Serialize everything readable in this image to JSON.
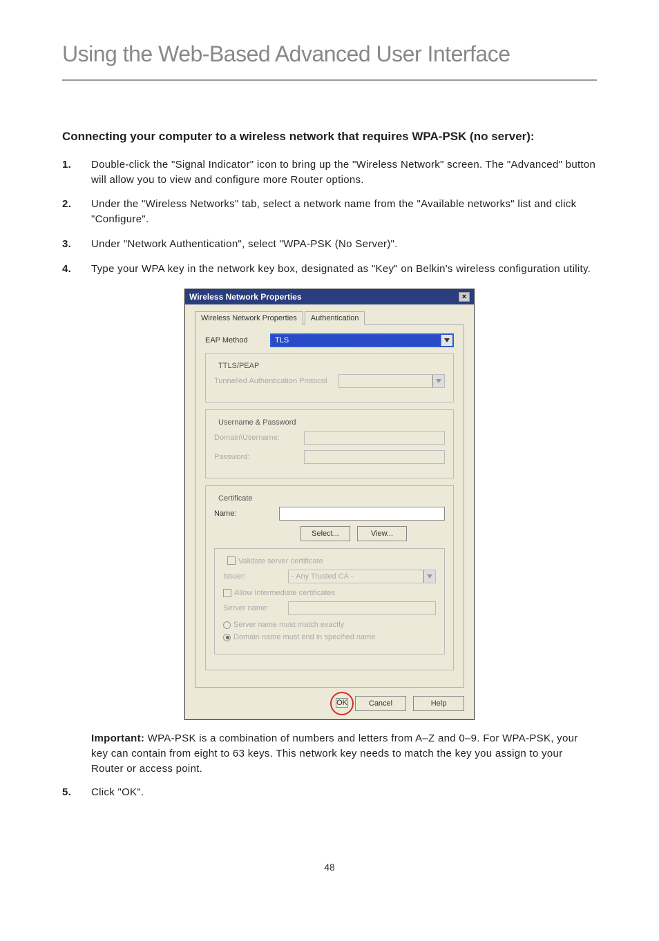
{
  "page_title": "Using the Web-Based Advanced User Interface",
  "sub_heading": "Connecting your computer to a wireless network that requires WPA-PSK (no server):",
  "steps": {
    "s1": {
      "num": "1.",
      "text": "Double-click the \"Signal Indicator\" icon to bring up the \"Wireless Network\" screen. The \"Advanced\" button will allow you to view and configure more Router options."
    },
    "s2": {
      "num": "2.",
      "text": "Under the \"Wireless Networks\" tab, select a network name from the \"Available networks\" list and click \"Configure\"."
    },
    "s3": {
      "num": "3.",
      "text": "Under \"Network Authentication\", select \"WPA-PSK (No Server)\"."
    },
    "s4": {
      "num": "4.",
      "text": "Type your WPA key in the network key box, designated as \"Key\" on Belkin's wireless configuration utility."
    },
    "s5": {
      "num": "5.",
      "text": "Click \"OK\"."
    }
  },
  "important_label": "Important:",
  "important_text": " WPA-PSK is a combination of numbers and letters from A–Z and 0–9. For WPA-PSK, your key can contain from eight to 63 keys. This network key needs to match the key you assign to your Router or access point.",
  "dialog": {
    "title": "Wireless Network Properties",
    "tab1": "Wireless Network Properties",
    "tab2": "Authentication",
    "eap_label": "EAP Method",
    "eap_value": "TLS",
    "ttls_title": "TTLS/PEAP",
    "ttls_proto_label": "Tunnelled Authentication Protocol",
    "userpass_title": "Username & Password",
    "domain_user_label": "Domain\\Username:",
    "password_label": "Password:",
    "cert_title": "Certificate",
    "name_label": "Name:",
    "select_btn": "Select...",
    "view_btn": "View...",
    "validate_title": "Validate server certificate",
    "issuer_label": "Issuer:",
    "issuer_value": "- Any Trusted CA -",
    "allow_intermediate": "Allow Intermediate certificates",
    "server_name_label": "Server name:",
    "radio_exact": "Server name must match exactly",
    "radio_domain": "Domain name must end in specified name",
    "ok_btn": "OK",
    "cancel_btn": "Cancel",
    "help_btn": "Help"
  },
  "page_number": "48"
}
